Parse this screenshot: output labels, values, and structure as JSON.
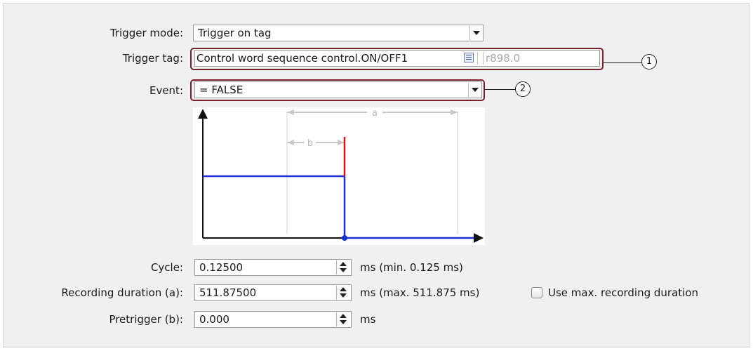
{
  "trigger_mode": {
    "label": "Trigger mode:",
    "value": "Trigger on tag"
  },
  "trigger_tag": {
    "label": "Trigger tag:",
    "value": "Control word sequence control.ON/OFF1",
    "parameter": "r898.0"
  },
  "event": {
    "label": "Event:",
    "value": "= FALSE"
  },
  "diagram": {
    "label_a": "a",
    "label_b": "b"
  },
  "cycle": {
    "label": "Cycle:",
    "value": "0.12500",
    "unit": "ms (min. 0.125 ms)"
  },
  "recording_duration": {
    "label": "Recording duration (a):",
    "value": "511.87500",
    "unit": "ms (max. 511.875 ms)",
    "max_checkbox_label": "Use max. recording duration",
    "max_checked": false
  },
  "pretrigger": {
    "label": "Pretrigger (b):",
    "value": "0.000",
    "unit": "ms"
  },
  "callouts": [
    "1",
    "2"
  ],
  "colors": {
    "highlight": "#7a1f2e",
    "signal": "#1a2fd6",
    "trigger_edge": "#e01010"
  }
}
